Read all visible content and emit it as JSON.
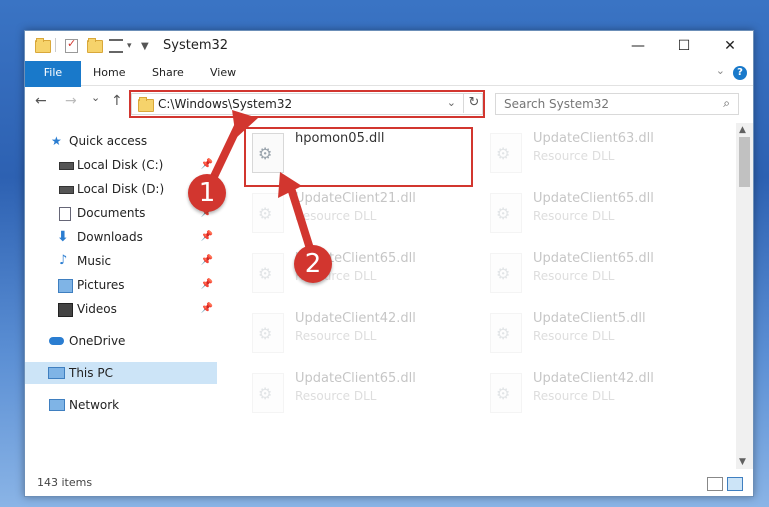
{
  "window": {
    "title": "System32",
    "controls": {
      "minimize": "—",
      "maximize": "☐",
      "close": "✕"
    }
  },
  "ribbon": {
    "tabs": [
      {
        "label": "File"
      },
      {
        "label": "Home"
      },
      {
        "label": "Share"
      },
      {
        "label": "View"
      }
    ],
    "help": "?"
  },
  "navigation": {
    "back": "←",
    "forward": "→",
    "recent": "⌄",
    "up": "↑"
  },
  "address": {
    "path": "C:\\Windows\\System32",
    "refresh": "↻"
  },
  "search": {
    "placeholder": "Search System32"
  },
  "sidebar": {
    "items": [
      {
        "label": "Quick access",
        "icon": "star-icon",
        "pinned": false
      },
      {
        "label": "Local Disk (C:)",
        "icon": "drive-icon",
        "pinned": true
      },
      {
        "label": "Local Disk (D:)",
        "icon": "drive-icon",
        "pinned": false
      },
      {
        "label": "Documents",
        "icon": "documents-icon",
        "pinned": true
      },
      {
        "label": "Downloads",
        "icon": "download-icon",
        "pinned": true
      },
      {
        "label": "Music",
        "icon": "music-icon",
        "pinned": true
      },
      {
        "label": "Pictures",
        "icon": "pictures-icon",
        "pinned": true
      },
      {
        "label": "Videos",
        "icon": "video-icon",
        "pinned": true
      },
      {
        "label": "OneDrive",
        "icon": "cloud-icon",
        "pinned": false
      },
      {
        "label": "This PC",
        "icon": "computer-icon",
        "pinned": false
      },
      {
        "label": "Network",
        "icon": "network-icon",
        "pinned": false
      }
    ],
    "selected": "This PC"
  },
  "files": [
    {
      "name": "hpomon05.dll",
      "type": ""
    },
    {
      "name": "UpdateClient63.dll",
      "type": "Resource DLL"
    },
    {
      "name": "UpdateClient21.dll",
      "type": "Resource DLL"
    },
    {
      "name": "UpdateClient65.dll",
      "type": "Resource DLL"
    },
    {
      "name": "UpdateClient65.dll",
      "type": "Resource DLL"
    },
    {
      "name": "UpdateClient65.dll",
      "type": "Resource DLL"
    },
    {
      "name": "UpdateClient42.dll",
      "type": "Resource DLL"
    },
    {
      "name": "UpdateClient5.dll",
      "type": "Resource DLL"
    },
    {
      "name": "UpdateClient65.dll",
      "type": "Resource DLL"
    },
    {
      "name": "UpdateClient42.dll",
      "type": "Resource DLL"
    }
  ],
  "status": {
    "item_count": "143 items"
  },
  "annotations": {
    "marker1": "1",
    "marker2": "2",
    "color": "#d2362f"
  },
  "colors": {
    "accent": "#1979ca",
    "selected_bg": "#cce4f7"
  }
}
